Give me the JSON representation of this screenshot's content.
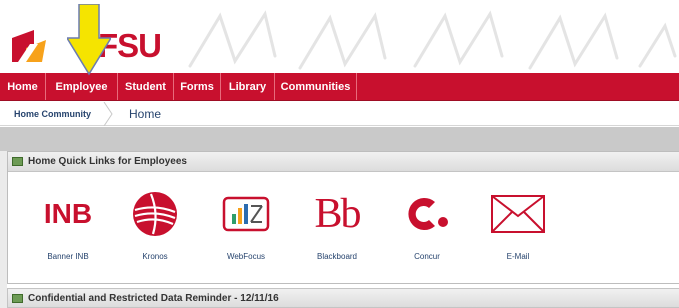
{
  "header": {
    "logo_text": "FSU",
    "brand_color": "#c8102e"
  },
  "nav": {
    "items": [
      {
        "label": "Home",
        "name": "nav-home"
      },
      {
        "label": "Employee",
        "name": "nav-employee"
      },
      {
        "label": "Student",
        "name": "nav-student"
      },
      {
        "label": "Forms",
        "name": "nav-forms"
      },
      {
        "label": "Library",
        "name": "nav-library"
      },
      {
        "label": "Communities",
        "name": "nav-communities"
      }
    ]
  },
  "breadcrumb": {
    "parent": "Home Community",
    "current": "Home"
  },
  "portlet": {
    "title": "Home Quick Links for Employees",
    "links": [
      {
        "label": "Banner INB",
        "icon_text": "INB",
        "icon": "inb-icon"
      },
      {
        "label": "Kronos",
        "icon": "kronos-icon"
      },
      {
        "label": "WebFocus",
        "icon": "webfocus-icon"
      },
      {
        "label": "Blackboard",
        "icon_text": "Bb",
        "icon": "blackboard-icon"
      },
      {
        "label": "Concur",
        "icon": "concur-icon"
      },
      {
        "label": "E-Mail",
        "icon": "email-icon"
      }
    ]
  },
  "portlet2": {
    "title": "Confidential and Restricted Data Reminder - 12/11/16"
  }
}
